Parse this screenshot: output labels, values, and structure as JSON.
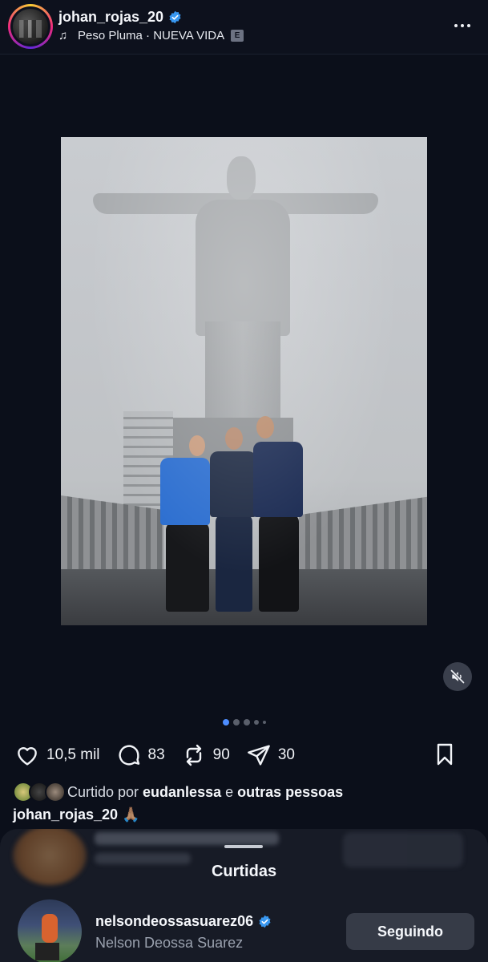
{
  "header": {
    "username": "johan_rojas_20",
    "music_artist": "Peso Pluma",
    "music_separator": " · ",
    "music_song": "NUEVA VIDA",
    "explicit_badge": "E",
    "icons": {
      "verified": "verified-badge-icon",
      "music": "music-note-icon",
      "more": "more-options-icon"
    }
  },
  "post": {
    "carousel": {
      "total_dots": 5,
      "active_index": 0
    },
    "mute_icon": "speaker-muted-icon"
  },
  "actions": {
    "likes": "10,5 mil",
    "comments": "83",
    "reposts": "90",
    "shares": "30",
    "icons": {
      "like": "heart-icon",
      "comment": "comment-bubble-icon",
      "repost": "repost-icon",
      "share": "send-icon",
      "save": "bookmark-icon"
    }
  },
  "liked_by": {
    "prefix": "Curtido por",
    "user": "eudanlessa",
    "conjunction": "e",
    "others": "outras pessoas"
  },
  "caption": {
    "username": "johan_rojas_20",
    "text": "🙏🏽"
  },
  "sheet": {
    "title": "Curtidas",
    "items": [
      {
        "username": "nelsondeossasuarez06",
        "full_name": "Nelson Deossa Suarez",
        "button": "Seguindo"
      }
    ]
  },
  "colors": {
    "background": "#0b0f1a",
    "accent": "#4d8dff",
    "verified": "#3897f0",
    "sheet": "#171b26"
  }
}
